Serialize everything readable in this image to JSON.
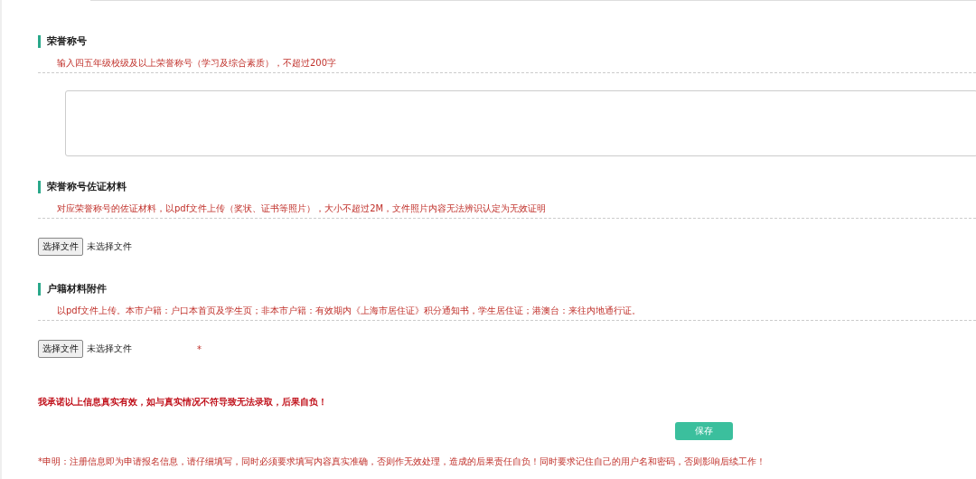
{
  "sections": [
    {
      "kind": "textarea",
      "title": "荣誉称号",
      "hint": "输入四五年级校级及以上荣誉称号（学习及综合素质），不超过200字"
    },
    {
      "kind": "file",
      "title": "荣誉称号佐证材料",
      "hint": "对应荣誉称号的佐证材料，以pdf文件上传（奖状、证书等照片），大小不超过2M，文件照片内容无法辨识认定为无效证明",
      "button": "选择文件",
      "status": "未选择文件"
    },
    {
      "kind": "file",
      "title": "户籍材料附件",
      "hint": "以pdf文件上传。本市户籍：户口本首页及学生页；非本市户籍：有效期内《上海市居住证》积分通知书，学生居住证；港澳台：来往内地通行证。",
      "button": "选择文件",
      "status": "未选择文件",
      "required": "*"
    }
  ],
  "pledge": "我承诺以上信息真实有效，如与真实情况不符导致无法录取，后果自负！",
  "save_button": "保存",
  "disclaimer": "*申明：注册信息即为申请报名信息，请仔细填写，同时必须要求填写内容真实准确，否则作无效处理，造成的后果责任自负！同时要求记住自己的用户名和密码，否则影响后续工作！"
}
